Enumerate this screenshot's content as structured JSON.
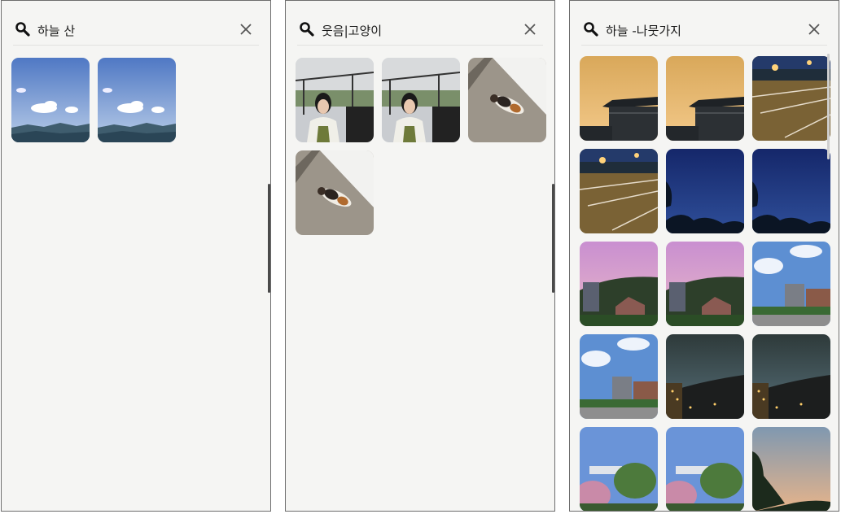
{
  "panels": [
    {
      "query": "하늘 산",
      "results": [
        "sky-mountain",
        "sky-mountain"
      ]
    },
    {
      "query": "웃음|고양이",
      "results": [
        "smiling-person",
        "smiling-person",
        "cat-on-stone",
        "cat-on-stone"
      ]
    },
    {
      "query": "하늘 -나뭇가지",
      "results": [
        "hanok-roof-sunset",
        "hanok-roof-sunset",
        "night-plaza-lamps",
        "night-plaza-lamps",
        "dusk-blue-sky-tree",
        "dusk-blue-sky-tree",
        "pink-sky-hill-houses",
        "pink-sky-hill-houses",
        "blue-sky-clouds-buildings",
        "blue-sky-clouds-buildings",
        "night-cloudy-city",
        "night-cloudy-city",
        "blue-sky-blossom-tree",
        "blue-sky-blossom-tree",
        "dusk-sky-treeline"
      ]
    }
  ]
}
